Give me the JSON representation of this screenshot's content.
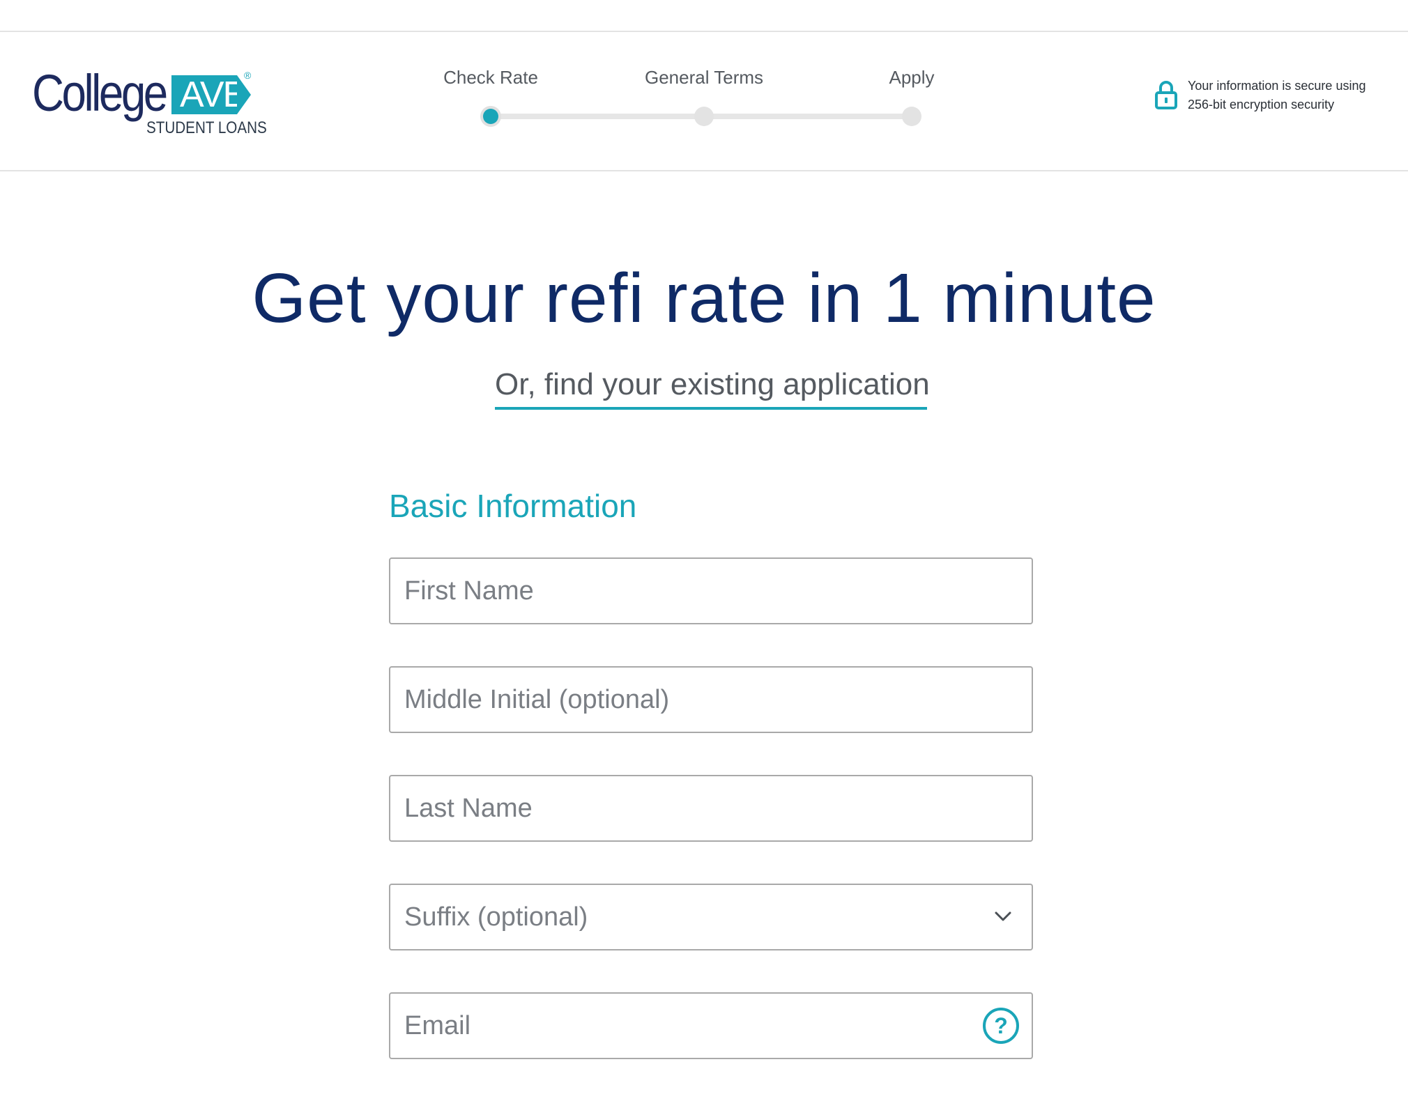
{
  "brand": {
    "logo_college": "College",
    "logo_ave": "AVE",
    "logo_registered": "®",
    "logo_subtitle": "STUDENT LOANS",
    "primary_color": "#0f2a66",
    "accent_color": "#1aa5b8"
  },
  "stepper": {
    "steps": [
      {
        "label": "Check Rate",
        "state": "active"
      },
      {
        "label": "General Terms",
        "state": "pending"
      },
      {
        "label": "Apply",
        "state": "pending"
      }
    ]
  },
  "security": {
    "icon": "lock-icon",
    "line1": "Your information is secure using",
    "line2": "256-bit encryption security"
  },
  "hero": {
    "headline": "Get your refi rate in 1 minute",
    "existing_link": "Or, find your existing application"
  },
  "form": {
    "section_title": "Basic Information",
    "first_name": {
      "placeholder": "First Name",
      "value": ""
    },
    "middle_initial": {
      "placeholder": "Middle Initial (optional)",
      "value": ""
    },
    "last_name": {
      "placeholder": "Last Name",
      "value": ""
    },
    "suffix": {
      "selected": "Suffix (optional)",
      "icon": "chevron-down-icon"
    },
    "email": {
      "placeholder": "Email",
      "value": "",
      "help_icon": "question-circle-icon",
      "help_glyph": "?"
    }
  }
}
